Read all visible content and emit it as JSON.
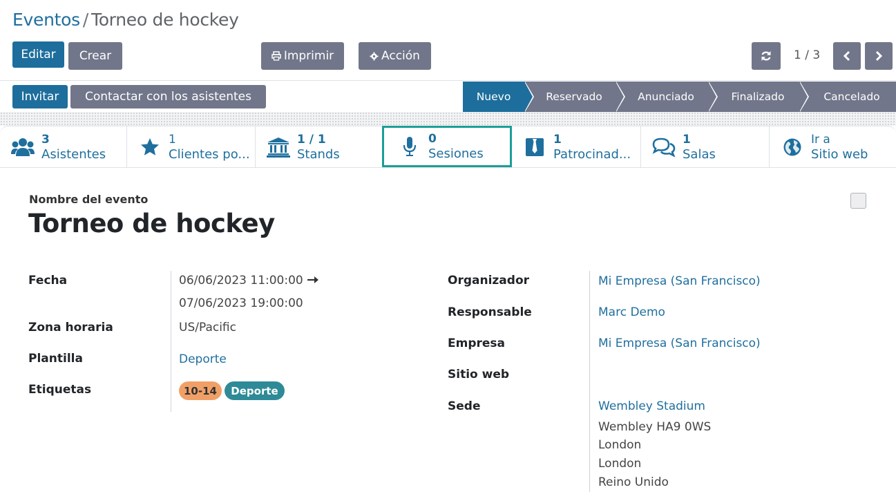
{
  "breadcrumb": {
    "parent": "Eventos",
    "separator": "/",
    "current": "Torneo de hockey"
  },
  "toolbar": {
    "edit": "Editar",
    "create": "Crear",
    "print": "Imprimir",
    "action": "Acción"
  },
  "pager": {
    "value": "1 / 3"
  },
  "header_buttons": {
    "invite": "Invitar",
    "contact": "Contactar con los asistentes"
  },
  "stages": [
    {
      "label": "Nuevo",
      "active": true
    },
    {
      "label": "Reservado",
      "active": false
    },
    {
      "label": "Anunciado",
      "active": false
    },
    {
      "label": "Finalizado",
      "active": false
    },
    {
      "label": "Cancelado",
      "active": false
    }
  ],
  "smart_buttons": [
    {
      "count": "3",
      "label": "Asistentes",
      "icon": "users-icon"
    },
    {
      "count": "1",
      "label": "Clientes po...",
      "icon": "star-icon"
    },
    {
      "count": "1 / 1",
      "label": "Stands",
      "icon": "bank-icon"
    },
    {
      "count": "0",
      "label": "Sesiones",
      "icon": "microphone-icon"
    },
    {
      "count": "1",
      "label": "Patrocinad...",
      "icon": "sponsor-icon"
    },
    {
      "count": "1",
      "label": "Salas",
      "icon": "comments-icon"
    },
    {
      "count": "Ir a",
      "label": "Sitio web",
      "icon": "globe-icon"
    }
  ],
  "form": {
    "name_label": "Nombre del evento",
    "name": "Torneo de hockey",
    "left": {
      "date_label": "Fecha",
      "date_start": "06/06/2023 11:00:00",
      "date_end": "07/06/2023 19:00:00",
      "tz_label": "Zona horaria",
      "tz": "US/Pacific",
      "template_label": "Plantilla",
      "template": "Deporte",
      "tags_label": "Etiquetas",
      "tags": [
        "10-14",
        "Deporte"
      ],
      "tag_colors": [
        "#f0a067",
        "#2e8a96"
      ]
    },
    "right": {
      "organizer_label": "Organizador",
      "organizer": "Mi Empresa (San Francisco)",
      "responsible_label": "Responsable",
      "responsible": "Marc Demo",
      "company_label": "Empresa",
      "company": "Mi Empresa (San Francisco)",
      "website_label": "Sitio web",
      "venue_label": "Sede",
      "venue_name": "Wembley Stadium",
      "venue_lines": [
        "Wembley HA9 0WS",
        "London",
        "London",
        "Reino Unido"
      ]
    }
  }
}
